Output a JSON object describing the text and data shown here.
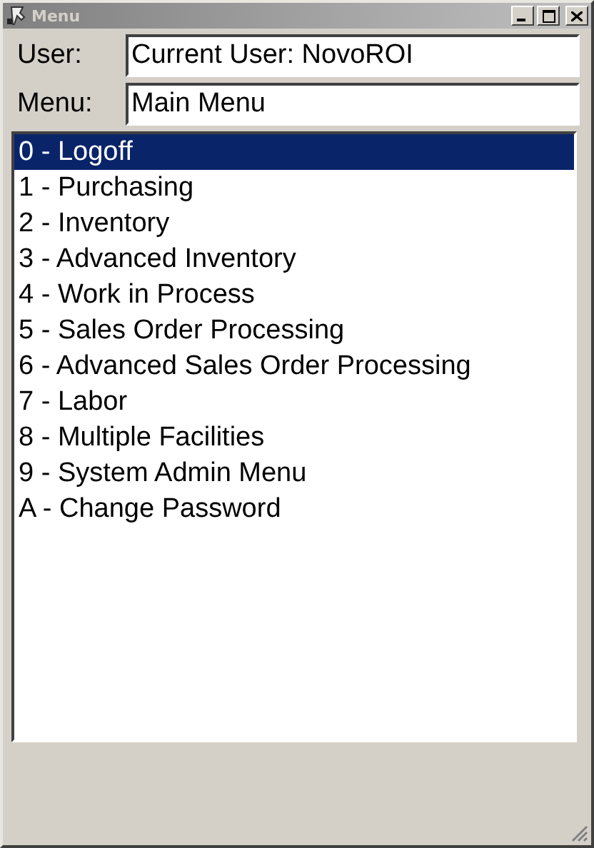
{
  "window": {
    "title": "Menu"
  },
  "fields": [
    {
      "label": "User:",
      "value": "Current User: NovoROI"
    },
    {
      "label": "Menu:",
      "value": "Main Menu"
    }
  ],
  "menu_items": [
    {
      "label": "0 - Logoff",
      "selected": true
    },
    {
      "label": "1 - Purchasing",
      "selected": false
    },
    {
      "label": "2 - Inventory",
      "selected": false
    },
    {
      "label": "3 - Advanced Inventory",
      "selected": false
    },
    {
      "label": "4 - Work in Process",
      "selected": false
    },
    {
      "label": "5 - Sales Order Processing",
      "selected": false
    },
    {
      "label": "6 - Advanced Sales Order Processing",
      "selected": false
    },
    {
      "label": "7 - Labor",
      "selected": false
    },
    {
      "label": "8 - Multiple Facilities",
      "selected": false
    },
    {
      "label": "9 - System Admin Menu",
      "selected": false
    },
    {
      "label": "A - Change Password",
      "selected": false
    }
  ]
}
